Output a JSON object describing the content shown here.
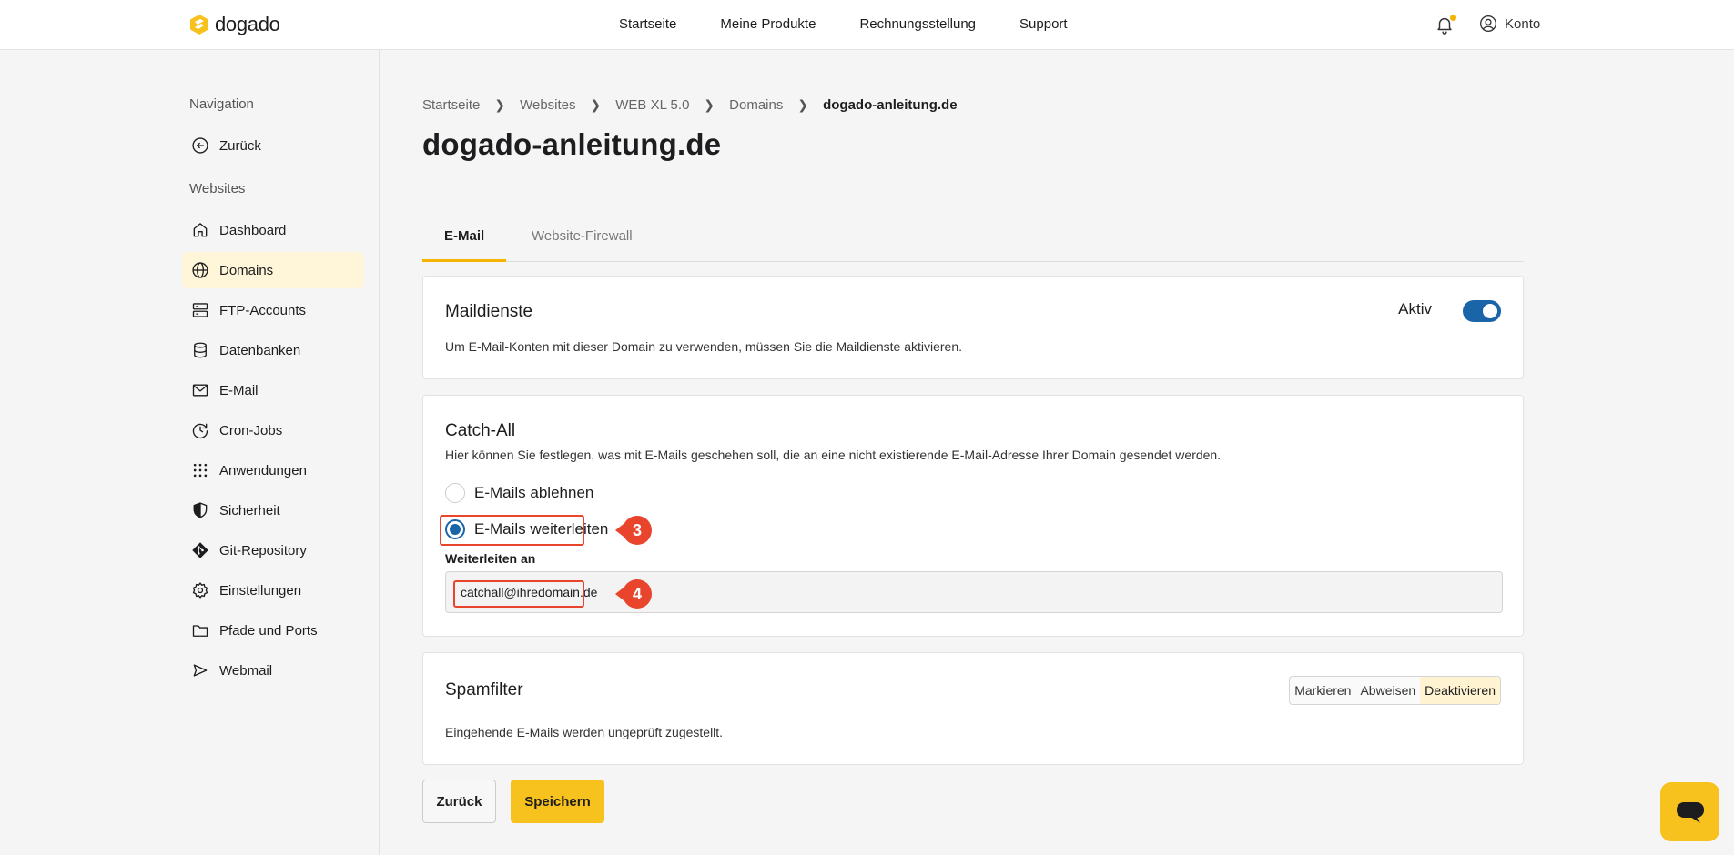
{
  "header": {
    "logo_text": "dogado",
    "nav": [
      "Startseite",
      "Meine Produkte",
      "Rechnungsstellung",
      "Support"
    ],
    "account_label": "Konto",
    "notification_dot_color": "#f4b400"
  },
  "sidebar": {
    "section_navigation": "Navigation",
    "back_label": "Zurück",
    "section_websites": "Websites",
    "items": [
      {
        "label": "Dashboard",
        "icon": "home-icon"
      },
      {
        "label": "Domains",
        "icon": "globe-icon",
        "active": true
      },
      {
        "label": "FTP-Accounts",
        "icon": "server-icon"
      },
      {
        "label": "Datenbanken",
        "icon": "database-icon"
      },
      {
        "label": "E-Mail",
        "icon": "mail-icon"
      },
      {
        "label": "Cron-Jobs",
        "icon": "clock-icon"
      },
      {
        "label": "Anwendungen",
        "icon": "grid-icon"
      },
      {
        "label": "Sicherheit",
        "icon": "shield-icon"
      },
      {
        "label": "Git-Repository",
        "icon": "git-icon"
      },
      {
        "label": "Einstellungen",
        "icon": "gear-icon"
      },
      {
        "label": "Pfade und Ports",
        "icon": "folder-icon"
      },
      {
        "label": "Webmail",
        "icon": "send-icon"
      }
    ]
  },
  "breadcrumb": [
    "Startseite",
    "Websites",
    "WEB XL 5.0",
    "Domains",
    "dogado-anleitung.de"
  ],
  "page_title": "dogado-anleitung.de",
  "tabs": [
    "E-Mail",
    "Website-Firewall"
  ],
  "maildienste": {
    "title": "Maildienste",
    "toggle_label": "Aktiv",
    "toggle_on": true,
    "description": "Um E-Mail-Konten mit dieser Domain zu verwenden, müssen Sie die Maildienste aktivieren."
  },
  "catch_all": {
    "title": "Catch-All",
    "description": "Hier können Sie festlegen, was mit E-Mails geschehen soll, die an eine nicht existierende E-Mail-Adresse Ihrer Domain gesendet werden.",
    "option_reject": "E-Mails ablehnen",
    "option_forward": "E-Mails weiterleiten",
    "selected": "forward",
    "forward_label": "Weiterleiten an",
    "forward_value": "catchall@ihredomain.de",
    "step_forward": "3",
    "step_input": "4"
  },
  "spamfilter": {
    "title": "Spamfilter",
    "options": [
      "Markieren",
      "Abweisen",
      "Deaktivieren"
    ],
    "selected": "Deaktivieren",
    "description": "Eingehende E-Mails werden ungeprüft zugestellt."
  },
  "buttons": {
    "back": "Zurück",
    "save": "Speichern"
  },
  "colors": {
    "accent": "#f7c21e",
    "primary": "#1a64a8",
    "annotation": "#e8452c"
  }
}
